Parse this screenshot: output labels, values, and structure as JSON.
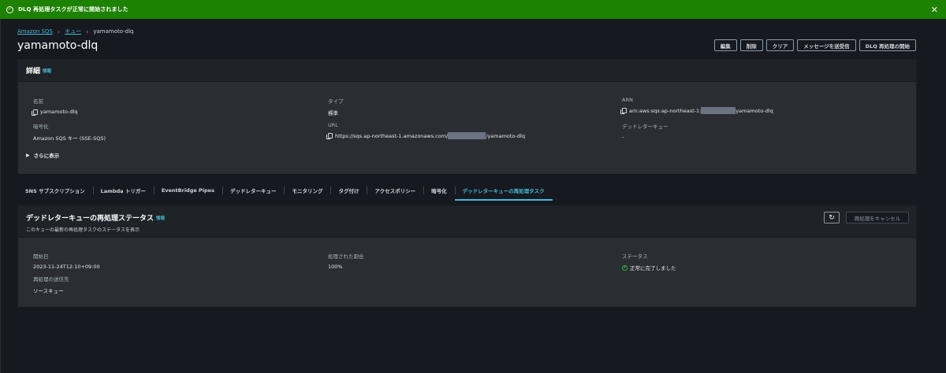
{
  "flash": {
    "message": "DLQ 再処理タスクが正常に開始されました"
  },
  "breadcrumb": {
    "items": [
      "Amazon SQS",
      "キュー",
      "yamamoto-dlq"
    ]
  },
  "page_title": "yamamoto-dlq",
  "actions": [
    "編集",
    "削除",
    "クリア",
    "メッセージを送受信",
    "DLQ 再処理の開始"
  ],
  "details": {
    "title": "詳細",
    "info": "情報",
    "fields": {
      "name_label": "名前",
      "name_value": "yamamoto-dlq",
      "type_label": "タイプ",
      "type_value": "標準",
      "arn_label": "ARN",
      "arn_prefix": "arn:aws:sqs:ap-northeast-1:",
      "arn_suffix": "yamamoto-dlq",
      "enc_label": "暗号化",
      "enc_value": "Amazon SQS キー (SSE-SQS)",
      "url_label": "URL",
      "url_prefix": "https://sqs.ap-northeast-1.amazonaws.com/",
      "url_suffix": "/yamamoto-dlq",
      "dlq_label": "デッドレターキュー",
      "dlq_value": "-"
    },
    "expand": "さらに表示"
  },
  "tabs": [
    "SNS サブスクリプション",
    "Lambda トリガー",
    "EventBridge Pipes",
    "デッドレターキュー",
    "モニタリング",
    "タグ付け",
    "アクセスポリシー",
    "暗号化",
    "デッドレターキューの再処理タスク"
  ],
  "active_tab": 8,
  "redrive": {
    "title": "デッドレターキューの再処理ステータス",
    "info": "情報",
    "subtitle": "このキューの最新の再処理タスクのステータスを表示",
    "cancel_label": "再処理をキャンセル",
    "refresh_icon": "refresh-icon",
    "fields": {
      "start_label": "開始日",
      "start_value": "2023-11-24T12:10+09:00",
      "processed_label": "処理された割合",
      "processed_value": "100%",
      "status_label": "ステータス",
      "status_value": "正常に完了しました",
      "dest_label": "再処理の送信先",
      "dest_value": "ソースキュー"
    }
  },
  "colors": {
    "success": "#1d8102",
    "link": "#44b9d6",
    "status_ok": "#29ad32"
  }
}
